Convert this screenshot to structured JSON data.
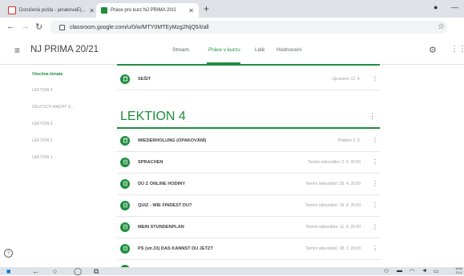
{
  "browser": {
    "tabs": [
      {
        "label": "Doručená pošta - janakovaE(...",
        "favicon": "gmail-icon",
        "active": false
      },
      {
        "label": "Práce pro kurz NJ PRIMA 20/2",
        "favicon": "classroom-icon",
        "active": true
      }
    ],
    "url": "classroom.google.com/u/0/w/MTY0MTEyMzg2NjQ5/t/all"
  },
  "app": {
    "title": "NJ PRIMA 20/21",
    "nav_tabs": [
      "Stream",
      "Práce v kurzu",
      "Lidé",
      "Hodnocení"
    ],
    "active_tab_index": 1
  },
  "sidebar": {
    "items": [
      "Všechna témata",
      "LEKTION 4",
      "DEUTSCH MACHT S...",
      "LEKTION 3",
      "LEKTION 2",
      "LEKTION 1"
    ],
    "active_index": 0
  },
  "main": {
    "top_item": {
      "title": "SEŠIT",
      "meta": "Upraveno 12. 4.",
      "type": "material"
    },
    "section": {
      "title": "LEKTION 4",
      "items": [
        {
          "title": "WIEDERHOLUNG (OPAKOVÁNÍ)",
          "meta": "Přidáno 2. 5.",
          "type": "material"
        },
        {
          "title": "SPRACHEN",
          "meta": "Termín odevzdání: 2. 5. 20:00",
          "type": "assignment"
        },
        {
          "title": "DÚ Z ONLINE HODINY",
          "meta": "Termín odevzdání: 25. 4. 20:00",
          "type": "assignment"
        },
        {
          "title": "QUIZ - WIE FINDEST DU?",
          "meta": "Termín odevzdání: 18. 4. 20:00",
          "type": "assignment"
        },
        {
          "title": "MEIN STUNDENPLAN",
          "meta": "Termín odevzdání: 11. 4. 20:00",
          "type": "assignment"
        },
        {
          "title": "PS (str.33) DAS KANNST DU JETZT",
          "meta": "Termín odevzdání: 28. 3. 20:00",
          "type": "assignment"
        }
      ]
    }
  },
  "taskbar": {
    "time": "19:50",
    "date": "22.4."
  },
  "colors": {
    "accent": "#1e8e3e",
    "text": "#3c4043",
    "muted": "#9aa0a6"
  }
}
